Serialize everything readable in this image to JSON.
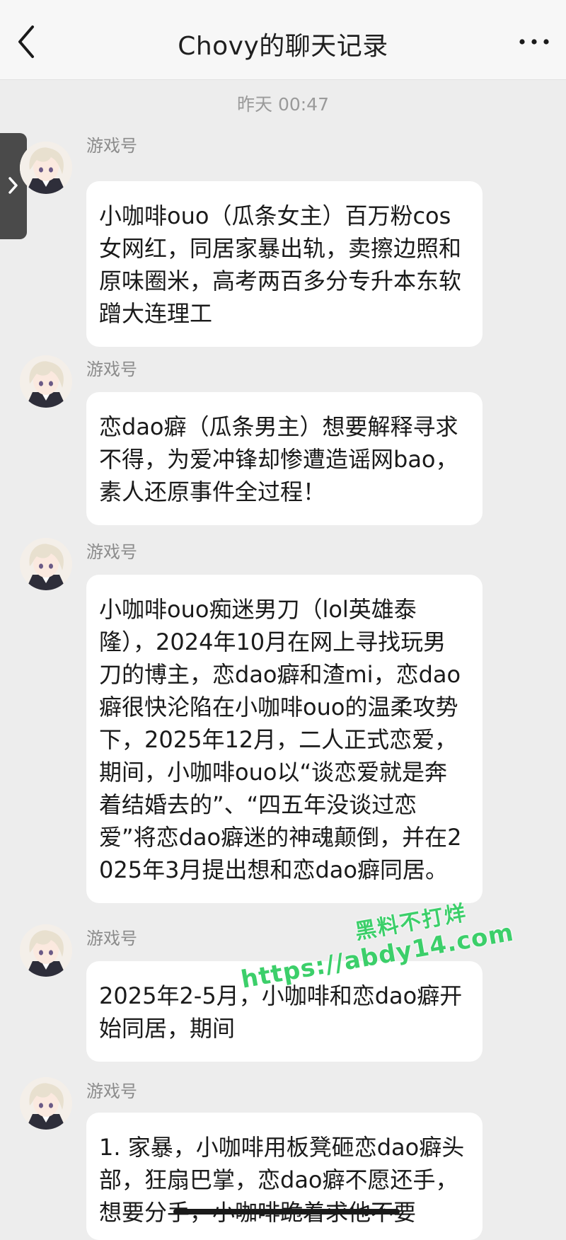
{
  "header": {
    "title": "Chovy的聊天记录"
  },
  "timestamp": "昨天 00:47",
  "messages": [
    {
      "sender": "游戏号",
      "text": "小咖啡ouo（瓜条女主）百万粉cos女网红，同居家暴出轨，卖擦边照和原味圈米，高考两百多分专升本东软蹭大连理工"
    },
    {
      "sender": "游戏号",
      "text": "恋dao癖（瓜条男主）想要解释寻求不得，为爱冲锋却惨遭造谣网bao，素人还原事件全过程！"
    },
    {
      "sender": "游戏号",
      "text": "小咖啡ouo痴迷男刀（lol英雄泰隆），2024年10月在网上寻找玩男刀的博主，恋dao癖和渣mi，恋dao癖很快沦陷在小咖啡ouo的温柔攻势下，2025年12月，二人正式恋爱，期间，小咖啡ouo以“谈恋爱就是奔着结婚去的”、“四五年没谈过恋爱”将恋dao癖迷的神魂颠倒，并在2025年3月提出想和恋dao癖同居。"
    },
    {
      "sender": "游戏号",
      "text": "2025年2-5月，小咖啡和恋dao癖开始同居，期间"
    },
    {
      "sender": "游戏号",
      "text": "1. 家暴，小咖啡用板凳砸恋dao癖头部，狂扇巴掌，恋dao癖不愿还手，想要分手，小咖啡跪着求他不要"
    }
  ],
  "watermark": {
    "line1": "黑料不打烊",
    "line2": "https://abdy14.com"
  },
  "colors": {
    "background": "#ededed",
    "bubble": "#ffffff",
    "watermark": "#3ccf6a"
  },
  "icons": {
    "back": "chevron-left-icon",
    "more": "more-dots-icon",
    "side": "chevron-right-icon"
  }
}
